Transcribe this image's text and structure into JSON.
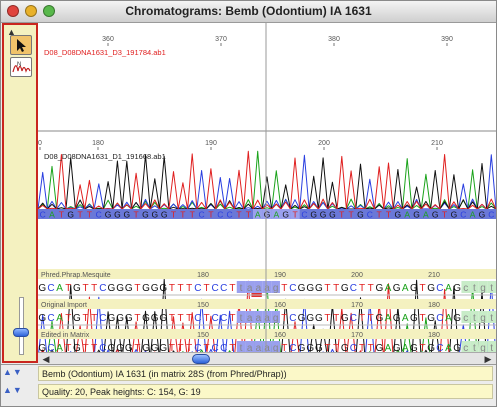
{
  "window": {
    "title": "Chromatograms: Bemb (Odontium) IA 1631",
    "lights": {
      "close": "#e0443e",
      "minimize": "#e8b12a",
      "zoom": "#58b84b"
    }
  },
  "colors": {
    "A": "#1aa31a",
    "C": "#2a3fe0",
    "G": "#111111",
    "T": "#e02020",
    "bar": "#6a78d8",
    "highlight": "#9aa0ee",
    "selected": "#d0d0ff",
    "sepbar": "#f4f1c0",
    "cursor": "#9a9a9a"
  },
  "tools": {
    "arrow_icon": "arrow-pointer-icon",
    "trace_icon": "trace-wave-icon",
    "palette_arrow": "▲"
  },
  "traces": [
    {
      "filename": "D08_D08DNA1631_D3_191784.ab1",
      "filename_color": "#e02020",
      "ruler": [
        {
          "label": "360"
        },
        {
          "label": "370"
        },
        {
          "label": "380"
        },
        {
          "label": "390"
        }
      ],
      "sequence": "CATGTTCGGGTGGGTTTCTCCTTAGAGTCGGGTTGCTTGAGAGTGCAGC"
    },
    {
      "filename": "D08_D08DNA1631_D1_191668.ab1",
      "filename_color": "#222222",
      "ruler": [
        {
          "label": "0"
        },
        {
          "label": "180"
        },
        {
          "label": "190"
        },
        {
          "label": "200"
        },
        {
          "label": "210"
        }
      ],
      "sequence": "CATGTTCGGGTGGGTTTCTCCTTAAAGTCGGGTTGCTTGAGAGTGCAGC"
    }
  ],
  "alignment_rows": [
    {
      "label": "Phred.Phrap.Mesquite",
      "ruler": [
        {
          "label": "180"
        },
        {
          "label": "190"
        },
        {
          "label": "200"
        },
        {
          "label": "210"
        },
        {
          "label": "220"
        }
      ],
      "sequence": "GCATGTTCGGGTGGGTTTCTCCTtaaagTCGGGTTGCTTGAGAGTGCAGctgt"
    },
    {
      "label": "Original Import",
      "ruler": [
        {
          "label": "150"
        },
        {
          "label": "160"
        },
        {
          "label": "170"
        },
        {
          "label": "180"
        },
        {
          "label": "190"
        }
      ],
      "sequence": "GCATGTTCGGGTGGGTTTCTCCTtaaagTCGGGTTGCTTGAGAGTGCAGctgt"
    },
    {
      "label": "Edited in Matrix",
      "ruler": [
        {
          "label": "150"
        },
        {
          "label": "160"
        },
        {
          "label": "170"
        },
        {
          "label": "180"
        },
        {
          "label": "190"
        }
      ],
      "sequence": "GCATGTTCGGGTGGGTTTCTCCTtaaagTCGGGTTGCTTGAGAGTGCAGctgt"
    }
  ],
  "info": {
    "line1": "Bemb (Odontium) IA 1631  (in matrix 28S (from Phred/Phrap))",
    "line2": "Quality: 20,   Peak heights: C: 154, G: 19",
    "updown_icon": "▲▼"
  },
  "scroll": {
    "left_arrow": "◀",
    "right_arrow": "▶",
    "position": 0.35
  },
  "zoom_slider": {
    "position": 0.62
  }
}
